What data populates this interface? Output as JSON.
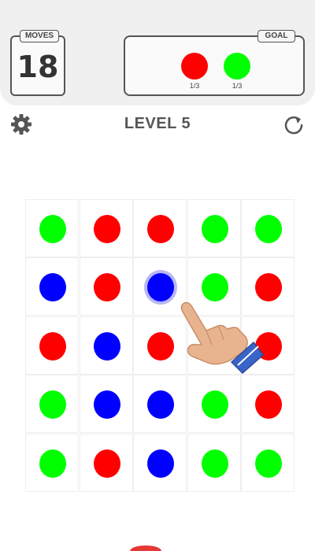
{
  "header": {
    "moves_label": "MOVES",
    "moves_value": "18",
    "goal_label": "GOAL",
    "goals": [
      {
        "color": "#ff0000",
        "count": "1/3"
      },
      {
        "color": "#00ff00",
        "count": "1/3"
      }
    ]
  },
  "toolbar": {
    "level_title": "LEVEL 5",
    "settings_icon": "gear-icon",
    "restart_icon": "restart-icon"
  },
  "colors": {
    "red": "#ff0000",
    "green": "#00ff00",
    "blue": "#0000ff"
  },
  "board": {
    "rows": 5,
    "cols": 5,
    "grid": [
      [
        "green",
        "red",
        "red",
        "green",
        "green"
      ],
      [
        "blue",
        "red",
        "blue",
        "green",
        "red"
      ],
      [
        "red",
        "blue",
        "red",
        "blue",
        "red"
      ],
      [
        "green",
        "blue",
        "blue",
        "green",
        "red"
      ],
      [
        "green",
        "red",
        "blue",
        "green",
        "green"
      ]
    ],
    "selected": {
      "row": 1,
      "col": 2
    }
  }
}
